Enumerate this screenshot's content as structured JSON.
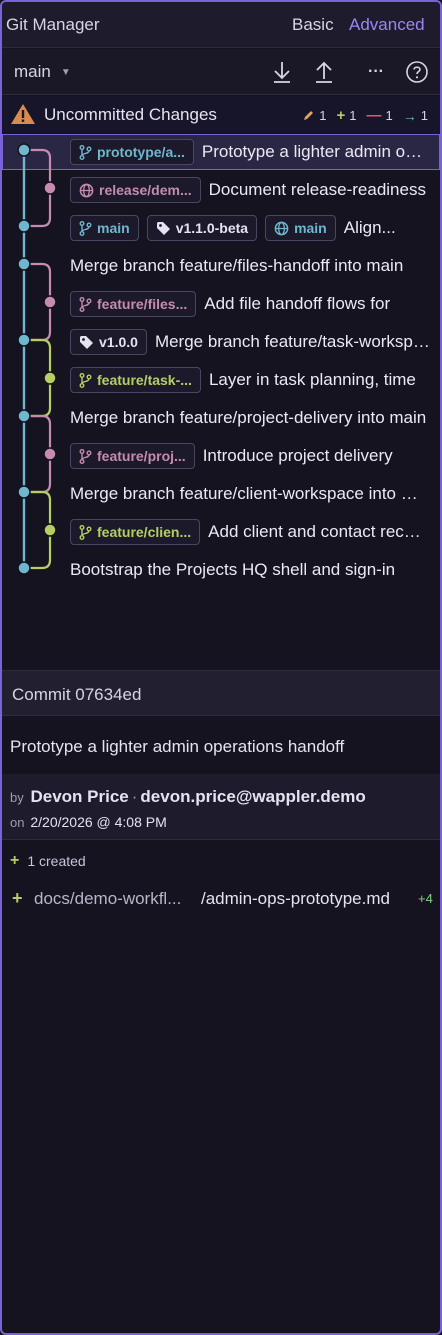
{
  "app": {
    "title": "Git Manager",
    "modes": {
      "basic": "Basic",
      "advanced": "Advanced",
      "active": "advanced"
    }
  },
  "toolbar": {
    "branch": "main",
    "icons": [
      "pull-icon",
      "push-icon",
      "more-icon",
      "help-icon"
    ],
    "more_label": "···"
  },
  "uncommitted": {
    "label": "Uncommitted Changes",
    "modified": "1",
    "added": "1",
    "deleted": "1",
    "renamed": "1"
  },
  "commits": [
    {
      "message": "Prototype a lighter admin operations handoff",
      "refs": [
        {
          "kind": "branch",
          "name": "prototype/a...",
          "color": "blue"
        }
      ],
      "selected": true
    },
    {
      "message": "Document release-readiness",
      "refs": [
        {
          "kind": "remote",
          "name": "release/dem...",
          "color": "pink"
        }
      ]
    },
    {
      "message": "Align...",
      "refs": [
        {
          "kind": "branch",
          "name": "main",
          "color": "blue"
        },
        {
          "kind": "tag",
          "name": "v1.1.0-beta",
          "color": "white"
        },
        {
          "kind": "remote",
          "name": "main",
          "color": "blue"
        }
      ]
    },
    {
      "message": "Merge branch feature/files-handoff into main",
      "refs": []
    },
    {
      "message": "Add file handoff flows for",
      "refs": [
        {
          "kind": "branch",
          "name": "feature/files...",
          "color": "pink"
        }
      ]
    },
    {
      "message": "Merge branch feature/task-workspace",
      "refs": [
        {
          "kind": "tag",
          "name": "v1.0.0",
          "color": "white"
        }
      ]
    },
    {
      "message": "Layer in task planning, time",
      "refs": [
        {
          "kind": "branch",
          "name": "feature/task-...",
          "color": "green"
        }
      ]
    },
    {
      "message": "Merge branch feature/project-delivery into main",
      "refs": []
    },
    {
      "message": "Introduce project delivery",
      "refs": [
        {
          "kind": "branch",
          "name": "feature/proj...",
          "color": "pink"
        }
      ]
    },
    {
      "message": "Merge branch feature/client-workspace into main",
      "refs": []
    },
    {
      "message": "Add client and contact records",
      "refs": [
        {
          "kind": "branch",
          "name": "feature/clien...",
          "color": "green"
        }
      ]
    },
    {
      "message": "Bootstrap the Projects HQ shell and sign-in",
      "refs": []
    }
  ],
  "detail": {
    "header": "Commit 07634ed",
    "message": "Prototype a lighter admin operations handoff",
    "by_label": "by",
    "author": "Devon Price",
    "email": "devon.price@wappler.demo",
    "on_label": "on",
    "date": "2/20/2026 @ 4:08 PM",
    "created_summary": "1 created",
    "files": [
      {
        "dir": "docs/demo-workfl...",
        "name": "/admin-ops-prototype.md",
        "additions": "+4"
      }
    ]
  },
  "colors": {
    "accent": "#7a63d6",
    "blue": "#6fb7cf",
    "pink": "#c68bb1",
    "green": "#b5cf62"
  }
}
